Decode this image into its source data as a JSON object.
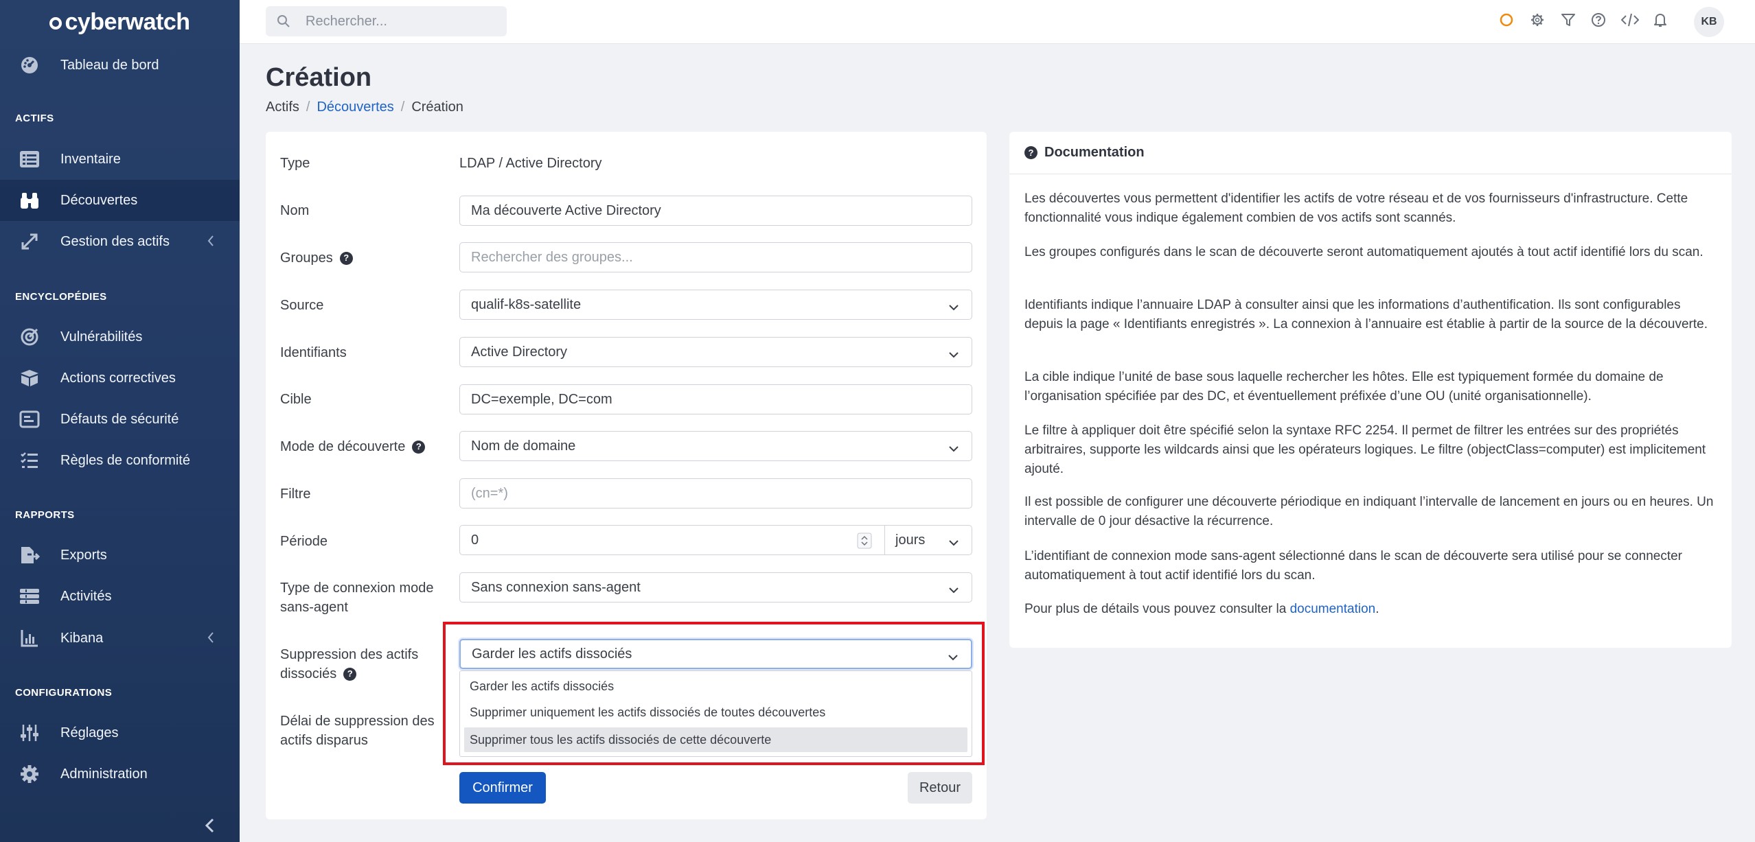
{
  "app": {
    "name": "cyberwatch"
  },
  "sidebar": {
    "items": [
      {
        "label": "Tableau de bord",
        "icon": "dashboard-icon"
      },
      {
        "label": "Inventaire",
        "icon": "list-icon"
      },
      {
        "label": "Découvertes",
        "icon": "binoculars-icon"
      },
      {
        "label": "Gestion des actifs",
        "icon": "expand-icon"
      },
      {
        "label": "Vulnérabilités",
        "icon": "target-icon"
      },
      {
        "label": "Actions correctives",
        "icon": "box-icon"
      },
      {
        "label": "Défauts de sécurité",
        "icon": "screen-icon"
      },
      {
        "label": "Règles de conformité",
        "icon": "checklist-icon"
      },
      {
        "label": "Exports",
        "icon": "export-icon"
      },
      {
        "label": "Activités",
        "icon": "activity-icon"
      },
      {
        "label": "Kibana",
        "icon": "chart-icon"
      },
      {
        "label": "Réglages",
        "icon": "sliders-icon"
      },
      {
        "label": "Administration",
        "icon": "gear-icon"
      }
    ],
    "sections": [
      "ACTIFS",
      "ENCYCLOPÉDIES",
      "RAPPORTS",
      "CONFIGURATIONS"
    ]
  },
  "topbar": {
    "search_placeholder": "Rechercher...",
    "avatar": "KB"
  },
  "page": {
    "title": "Création",
    "breadcrumb": [
      "Actifs",
      "Découvertes",
      "Création"
    ]
  },
  "form": {
    "type_label": "Type",
    "type_value": "LDAP / Active Directory",
    "name_label": "Nom",
    "name_value": "Ma découverte Active Directory",
    "groups_label": "Groupes",
    "groups_placeholder": "Rechercher des groupes...",
    "source_label": "Source",
    "source_value": "qualif-k8s-satellite",
    "credentials_label": "Identifiants",
    "credentials_value": "Active Directory",
    "target_label": "Cible",
    "target_value": "DC=exemple, DC=com",
    "mode_label": "Mode de découverte",
    "mode_value": "Nom de domaine",
    "filter_label": "Filtre",
    "filter_placeholder": "(cn=*)",
    "period_label": "Période",
    "period_value": "0",
    "period_unit": "jours",
    "agentless_label_1": "Type de connexion mode",
    "agentless_label_2": "sans-agent",
    "agentless_value": "Sans connexion sans-agent",
    "deletion_label_1": "Suppression des actifs",
    "deletion_label_2": "dissociés",
    "deletion_value": "Garder les actifs dissociés",
    "deletion_options": [
      "Garder les actifs dissociés",
      "Supprimer uniquement les actifs dissociés de toutes découvertes",
      "Supprimer tous les actifs dissociés de cette découverte"
    ],
    "delay_label_1": "Délai de suppression des",
    "delay_label_2": "actifs disparus",
    "confirm": "Confirmer",
    "back": "Retour"
  },
  "doc": {
    "title": "Documentation",
    "p1": "Les découvertes vous permettent d'identifier les actifs de votre réseau et de vos fournisseurs d'infrastructure. Cette fonctionnalité vous indique également combien de vos actifs sont scannés.",
    "p2": "Les groupes configurés dans le scan de découverte seront automatiquement ajoutés à tout actif identifié lors du scan.",
    "p3": "Identifiants indique l’annuaire LDAP à consulter ainsi que les informations d’authentification. Ils sont configurables depuis la page « Identifiants enregistrés ». La connexion à l’annuaire est établie à partir de la source de la découverte.",
    "p4": "La cible indique l’unité de base sous laquelle rechercher les hôtes. Elle est typiquement formée du domaine de l’organisation spécifiée par des DC, et éventuellement préfixée d’une OU (unité organisationnelle).",
    "p5": "Le filtre à appliquer doit être spécifié selon la syntaxe RFC 2254. Il permet de filtrer les entrées sur des propriétés arbitraires, supporte les wildcards ainsi que les opérateurs logiques. Le filtre (objectClass=computer) est implicitement ajouté.",
    "p6": "Il est possible de configurer une découverte périodique en indiquant l’intervalle de lancement en jours ou en heures. Un intervalle de 0 jour désactive la récurrence.",
    "p7": "L’identifiant de connexion mode sans-agent sélectionné dans le scan de découverte sera utilisé pour se connecter automatiquement à tout actif identifié lors du scan.",
    "p8_prefix": "Pour plus de détails vous pouvez consulter la ",
    "p8_link": "documentation",
    "p8_suffix": "."
  }
}
